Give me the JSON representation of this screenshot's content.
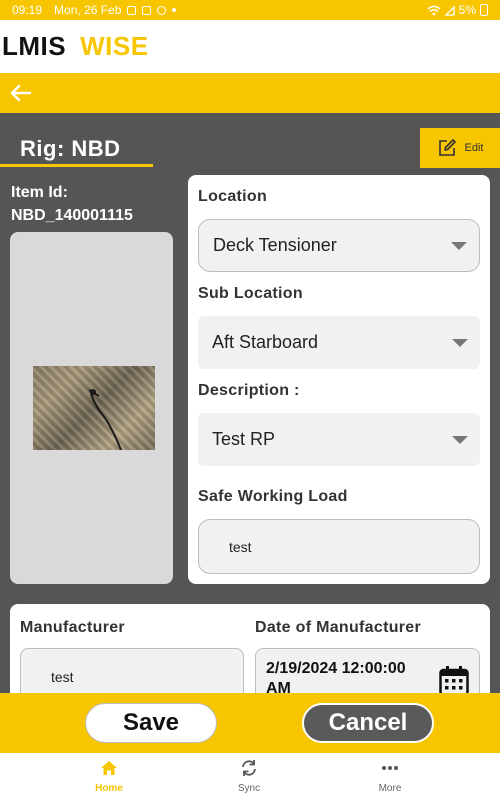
{
  "status_bar": {
    "time": "09:19",
    "date": "Mon, 26 Feb",
    "battery": "5%"
  },
  "app": {
    "brand_primary": "LMIS",
    "brand_secondary": "WISE"
  },
  "colors": {
    "accent": "#f7c600",
    "background": "#555555",
    "card": "#ffffff"
  },
  "rig": {
    "title": "Rig:  NBD"
  },
  "edit": {
    "label": "Edit"
  },
  "item": {
    "id_label": "Item Id:",
    "id_value": "NBD_140001115"
  },
  "form": {
    "location_label": "Location",
    "location_value": "Deck Tensioner",
    "sub_location_label": "Sub Location",
    "sub_location_value": "Aft Starboard",
    "description_label": "Description :",
    "description_value": "Test RP",
    "swl_label": "Safe Working Load",
    "swl_value": "test"
  },
  "details": {
    "manufacturer_label": "Manufacturer",
    "manufacturer_value": "test",
    "date_label": "Date of Manufacturer",
    "date_value": "2/19/2024 12:00:00 AM"
  },
  "actions": {
    "save": "Save",
    "cancel": "Cancel"
  },
  "bottom_nav": [
    {
      "label": "Home",
      "icon": "home-icon",
      "active": true
    },
    {
      "label": "Sync",
      "icon": "sync-icon",
      "active": false
    },
    {
      "label": "More",
      "icon": "more-icon",
      "active": false
    }
  ]
}
